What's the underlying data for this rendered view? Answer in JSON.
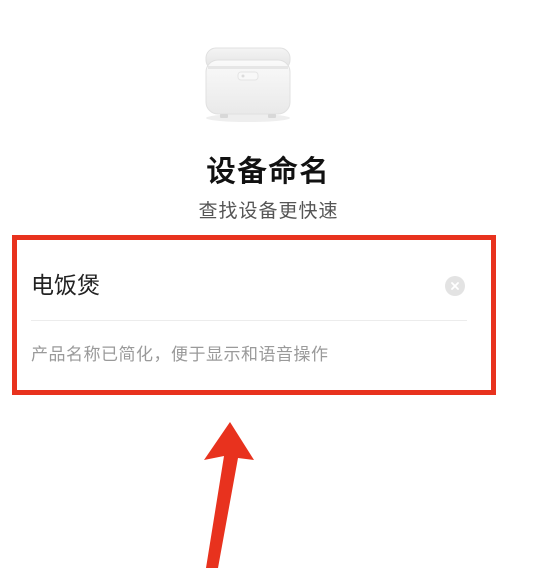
{
  "header": {
    "device_image": "rice-cooker-image",
    "title": "设备命名",
    "subtitle": "查找设备更快速"
  },
  "name_field": {
    "value": "电饭煲",
    "clear_icon": "clear-circle-icon",
    "hint": "产品名称已简化，便于显示和语音操作"
  },
  "annotation": {
    "highlight_color": "#e8321e",
    "arrow_color": "#e8321e"
  }
}
